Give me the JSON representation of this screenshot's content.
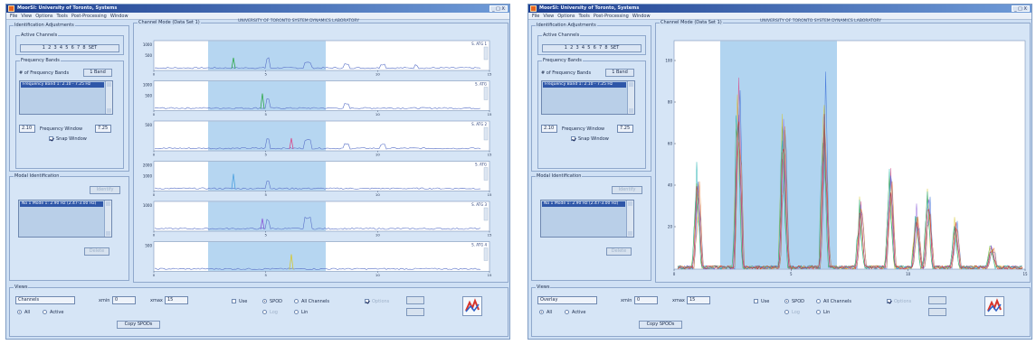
{
  "left": {
    "title": "MoorSI: University of Toronto, Systems",
    "win_controls": "_ □ X",
    "lab_title": "UNIVERSITY OF TORONTO  SYSTEM DYNAMICS LABORATORY",
    "menu": [
      "File",
      "View",
      "Options",
      "Tools",
      "Post-Processing",
      "Window"
    ],
    "ident_group": "Identification Adjustments",
    "active_channels_group": "Active Channels",
    "channels": [
      "1",
      "2",
      "3",
      "4",
      "5",
      "6",
      "7",
      "8"
    ],
    "channel_button": "SET",
    "freq_group": "Frequency Bands",
    "num_bands_label": "# of Frequency Bands",
    "num_bands_value": "1 Band",
    "band_item": "Frequency Band 1: 2.10 - 7.25 Hz",
    "freq_low": "2.10",
    "freq_mid_label": "Frequency Window",
    "freq_high": "7.25",
    "snap_label": "Snap Window",
    "modal_group": "Modal Identification",
    "modal_button": "Identify",
    "mode_item": "No 1 Mode 1: 2.90 Hz (2.47-3.00 Hz)",
    "delete_button": "Delete",
    "plot_group": "Channel Mode (Data Set 1)",
    "channel_tags": [
      "S. ATG 1",
      "S. ATG",
      "S. ATG 2",
      "S. ATG",
      "S. ATG 3",
      "S. ATG 4"
    ],
    "y_ticks": [
      [
        "1000",
        "500"
      ],
      [
        "1000",
        "500"
      ],
      [
        "500"
      ],
      [
        "2000",
        "1000"
      ],
      [
        "1000"
      ],
      [
        "500"
      ]
    ],
    "x_ticks": [
      "0",
      "5",
      "10",
      "15"
    ],
    "bottom_group": "Views",
    "view_select": "Channels",
    "fmin_label": "xmin",
    "fmin_value": "0",
    "fmax_label": "xmax",
    "fmax_value": "15",
    "opt1": "Use",
    "opt2": "SPOD",
    "opt3": "All Channels",
    "opt4": "Log",
    "opt5": "Lin",
    "opt_disabled": "Options",
    "radio_all": "All",
    "radio_active": "Active",
    "plot_button": "Copy SPODs"
  },
  "right": {
    "title": "MoorSI: University of Toronto, Systems",
    "win_controls": "_ □ X",
    "lab_title": "UNIVERSITY OF TORONTO  SYSTEM DYNAMICS LABORATORY",
    "plot_group": "Channel Mode (Data Set 1)",
    "y_ticks": [
      "100",
      "80",
      "60",
      "40",
      "20"
    ],
    "x_ticks": [
      "0",
      "5",
      "10",
      "15"
    ],
    "view_select": "Overlay"
  },
  "colors": {
    "window_bg": "#cfe0f4",
    "title_start": "#1e3f8f",
    "title_end": "#6f9bd8",
    "band_highlight": "#a9cfee",
    "selection": "#2f57a8"
  }
}
